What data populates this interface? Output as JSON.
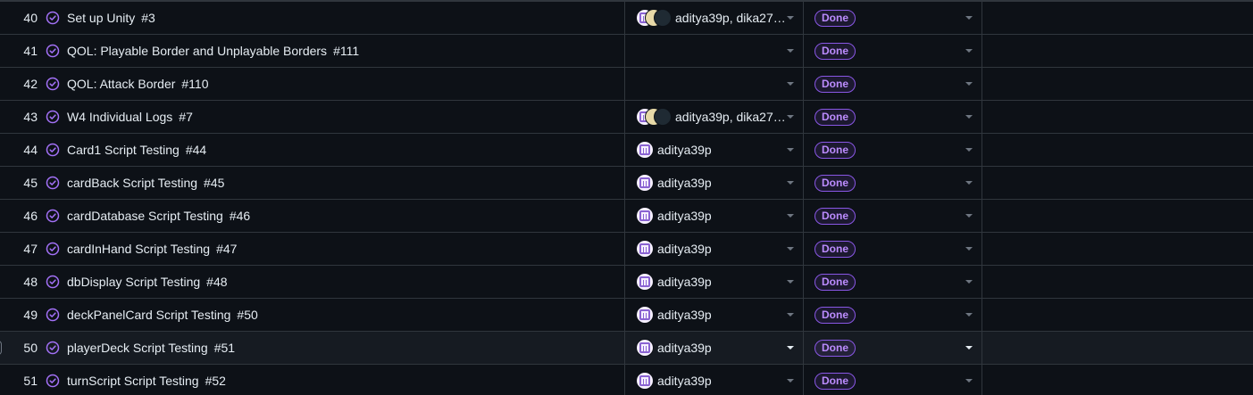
{
  "colors": {
    "background": "#0d1117",
    "border": "#30363d",
    "done_purple": "#bc8cff",
    "done_border": "#8957e5"
  },
  "rows": [
    {
      "num": "40",
      "title": "Set up Unity",
      "issue": "#3",
      "assignee": "aditya39p, dika27…",
      "multi": true,
      "status": "Done"
    },
    {
      "num": "41",
      "title": "QOL: Playable Border and Unplayable Borders",
      "issue": "#111",
      "assignee": "",
      "multi": false,
      "status": "Done"
    },
    {
      "num": "42",
      "title": "QOL: Attack Border",
      "issue": "#110",
      "assignee": "",
      "multi": false,
      "status": "Done"
    },
    {
      "num": "43",
      "title": "W4 Individual Logs",
      "issue": "#7",
      "assignee": "aditya39p, dika27…",
      "multi": true,
      "status": "Done"
    },
    {
      "num": "44",
      "title": "Card1 Script Testing",
      "issue": "#44",
      "assignee": "aditya39p",
      "multi": false,
      "status": "Done"
    },
    {
      "num": "45",
      "title": "cardBack Script Testing",
      "issue": "#45",
      "assignee": "aditya39p",
      "multi": false,
      "status": "Done"
    },
    {
      "num": "46",
      "title": "cardDatabase Script Testing",
      "issue": "#46",
      "assignee": "aditya39p",
      "multi": false,
      "status": "Done"
    },
    {
      "num": "47",
      "title": "cardInHand Script Testing",
      "issue": "#47",
      "assignee": "aditya39p",
      "multi": false,
      "status": "Done"
    },
    {
      "num": "48",
      "title": "dbDisplay Script Testing",
      "issue": "#48",
      "assignee": "aditya39p",
      "multi": false,
      "status": "Done"
    },
    {
      "num": "49",
      "title": "deckPanelCard Script Testing",
      "issue": "#50",
      "assignee": "aditya39p",
      "multi": false,
      "status": "Done"
    },
    {
      "num": "50",
      "title": "playerDeck Script Testing",
      "issue": "#51",
      "assignee": "aditya39p",
      "multi": false,
      "status": "Done",
      "hovered": true
    },
    {
      "num": "51",
      "title": "turnScript Script Testing",
      "issue": "#52",
      "assignee": "aditya39p",
      "multi": false,
      "status": "Done"
    }
  ]
}
